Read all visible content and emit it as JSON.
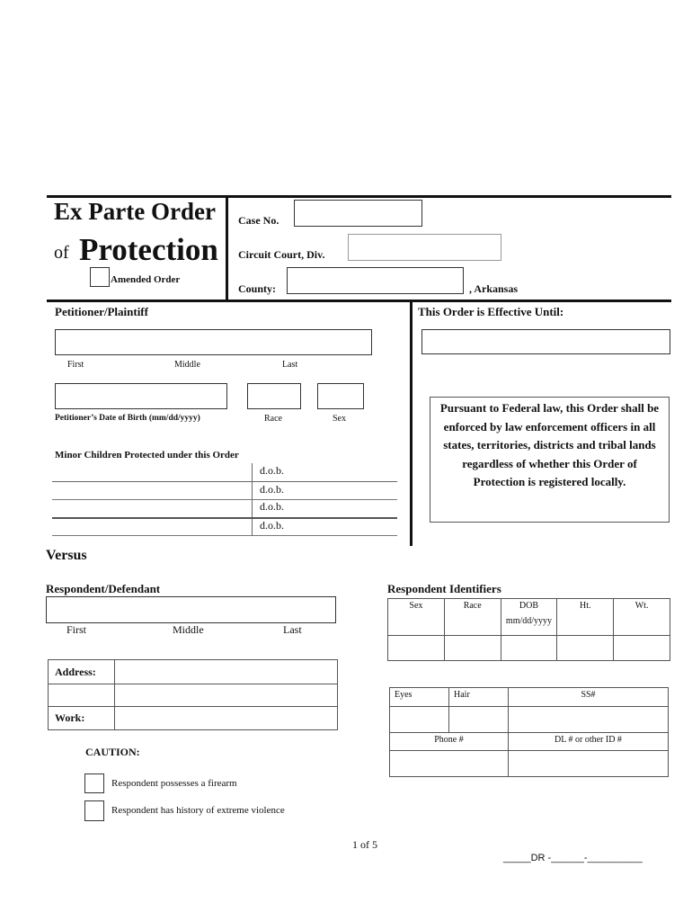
{
  "header": {
    "title_line1": "Ex Parte Order",
    "title_of": "of",
    "title_line2": "Protection",
    "amended_order_label": "Amended Order",
    "case_no_label": "Case No.",
    "circuit_court_label": "Circuit Court, Div.",
    "county_label": "County:",
    "state_suffix": ", Arkansas"
  },
  "fields": {
    "case_no": "",
    "circuit_court_div": "",
    "county": "",
    "effective_until": "",
    "petitioner_name": "",
    "petitioner_dob": "",
    "petitioner_race": "",
    "petitioner_sex": "",
    "respondent_name": ""
  },
  "petitioner": {
    "heading": "Petitioner/Plaintiff",
    "name_parts": [
      "First",
      "Middle",
      "Last"
    ],
    "dob_label": "Petitioner’s Date of Birth (mm/dd/yyyy)",
    "race_label": "Race",
    "sex_label": "Sex"
  },
  "effective": {
    "heading": "This Order is Effective Until:"
  },
  "federal_notice": "Pursuant to Federal law, this Order shall be enforced by law enforcement officers in all states, territories, districts and tribal lands regardless of whether this Order of Protection is registered locally.",
  "minor_children": {
    "heading": "Minor Children Protected under this Order",
    "rows": [
      {
        "name": "",
        "dob_label": "d.o.b."
      },
      {
        "name": "",
        "dob_label": "d.o.b."
      },
      {
        "name": "",
        "dob_label": "d.o.b."
      },
      {
        "name": "",
        "dob_label": "d.o.b."
      }
    ]
  },
  "versus": "Versus",
  "respondent": {
    "heading": "Respondent/Defendant",
    "name_parts": [
      "First",
      "Middle",
      "Last"
    ],
    "address_label": "Address:",
    "work_label": "Work:"
  },
  "identifiers": {
    "heading": "Respondent Identifiers",
    "table1_headers": [
      "Sex",
      "Race",
      "DOB",
      "Ht.",
      "Wt."
    ],
    "dob_format": "mm/dd/yyyy",
    "table2_headers": [
      "Eyes",
      "Hair",
      "SS#"
    ],
    "table2_row2_headers": [
      "Phone #",
      "DL # or other ID #"
    ]
  },
  "caution": {
    "heading": "CAUTION:",
    "items": [
      {
        "label": "Respondent possesses a firearm",
        "checked": false
      },
      {
        "label": "Respondent has history of extreme violence",
        "checked": false
      }
    ]
  },
  "footer": {
    "page": "1 of 5",
    "dr_number": "_____DR -______-__________"
  }
}
